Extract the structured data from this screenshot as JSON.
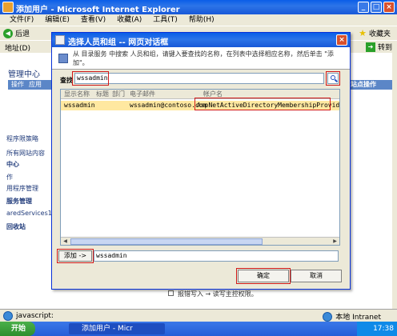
{
  "window": {
    "title": "添加用户 - Microsoft Internet Explorer",
    "menu": [
      "文件(F)",
      "编辑(E)",
      "查看(V)",
      "收藏(A)",
      "工具(T)",
      "帮助(H)"
    ],
    "back_label": "后退",
    "favorites_label": "收藏夹",
    "address_label": "地址(D)",
    "go_label": "转到"
  },
  "background": {
    "mgmt_title": "管理中心",
    "tab_operations": "操作",
    "tab_app": "应用",
    "right_tab": "站点操作",
    "links": [
      "程序限策略",
      "所有网站内容",
      "中心",
      "作",
      "用程序管理",
      "服务管理",
      "aredServices1",
      "回收站"
    ],
    "bottom_text": "报错写入 → 读写主控权限。"
  },
  "dialog": {
    "title": "选择人员和组 -- 网页对话框",
    "instructions": "从 目录服务 中搜索 人员和组，请键入要查找的名称，在列表中选择相应名称，然后单击 \"添加\"。",
    "find_label": "查找",
    "find_value": "wssadmin",
    "columns": [
      "显示名称",
      "标题",
      "部门",
      "电子邮件",
      "帐户名"
    ],
    "rows": [
      {
        "display_name": "wssadmin",
        "title": "",
        "department": "",
        "email": "wssadmin@contoso.com",
        "account": "AspNetActiveDirectoryMembershipProvider:wssadmin"
      }
    ],
    "add_label": "添加 ->",
    "added_value": "wssadmin",
    "ok_label": "确定",
    "cancel_label": "取消"
  },
  "status": {
    "left_text": "javascript:",
    "zone": "本地 Intranet"
  },
  "taskbar": {
    "start": "开始",
    "task_label": "添加用户 - Micr",
    "clock": "17:38"
  }
}
